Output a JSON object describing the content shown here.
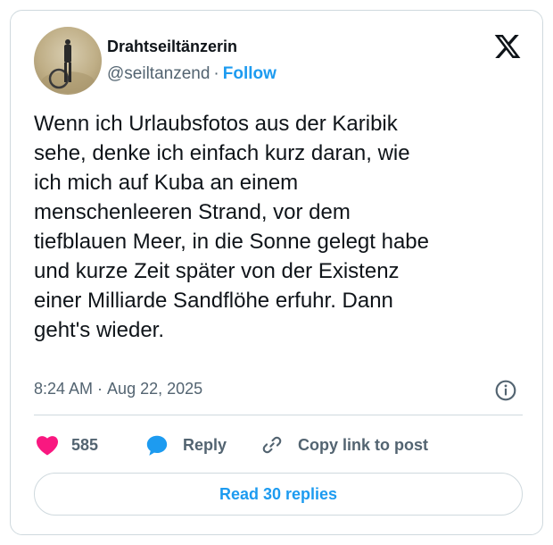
{
  "author": {
    "display_name": "Drahtseiltänzerin",
    "handle": "@seiltanzend",
    "separator": "·",
    "follow_label": "Follow"
  },
  "tweet": {
    "text": "Wenn ich Urlaubsfotos aus der Karibik\nsehe, denke ich einfach kurz daran, wie\nich mich auf Kuba an einem\nmenschenleeren Strand, vor dem\ntiefblauen Meer, in die Sonne gelegt habe\nund kurze Zeit später von der Existenz\neiner Milliarde Sandflöhe erfuhr. Dann\ngeht's wieder.",
    "time": "8:24 AM",
    "separator": "·",
    "date": "Aug 22, 2025"
  },
  "actions": {
    "like_count": "585",
    "reply_label": "Reply",
    "copy_link_label": "Copy link to post"
  },
  "read_replies_label": "Read 30 replies",
  "icons": {
    "like": "heart-icon",
    "reply": "speech-bubble-icon",
    "copy": "link-icon",
    "info": "info-icon",
    "brand": "x-logo-icon"
  },
  "colors": {
    "accent": "#1d9bf0",
    "like": "#f91880",
    "text": "#0f1419",
    "muted": "#536471",
    "border": "#cfd9de"
  }
}
